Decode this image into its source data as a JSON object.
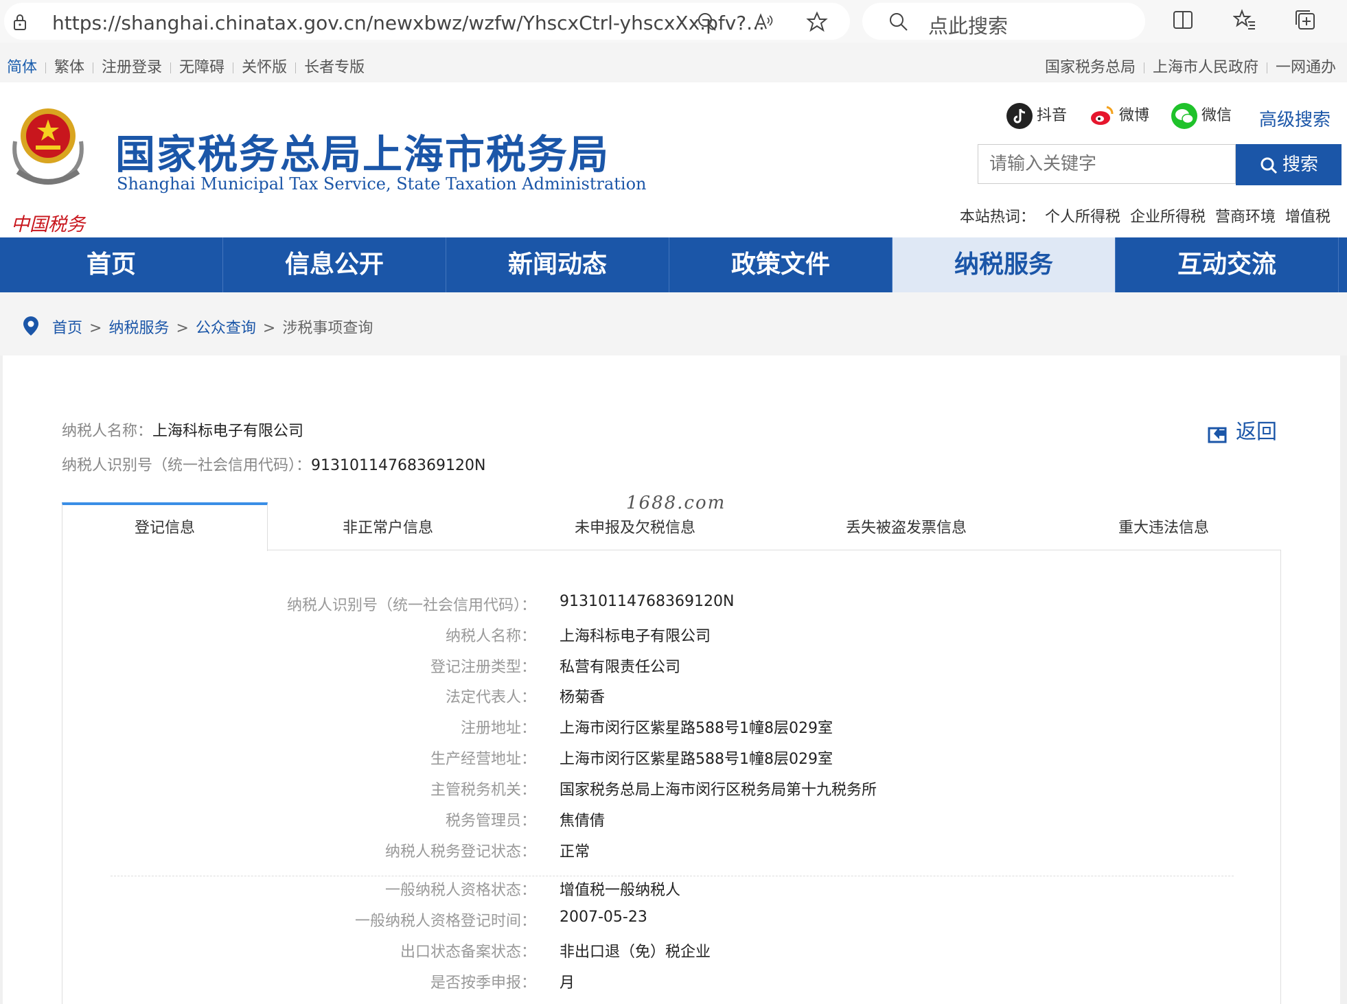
{
  "browser": {
    "url": "https://shanghai.chinatax.gov.cn/newxbwz/wzfw/YhscxCtrl-yhscxXx.pfv?...",
    "search_placeholder": "点此搜索"
  },
  "utility": {
    "left": [
      "简体",
      "繁体",
      "注册登录",
      "无障碍",
      "关怀版",
      "长者专版"
    ],
    "right": [
      "国家税务总局",
      "上海市人民政府",
      "一网通办"
    ]
  },
  "header": {
    "title": "国家税务总局上海市税务局",
    "subtitle": "Shanghai Municipal Tax Service, State Taxation Administration",
    "emblem_text": "中国税务",
    "social": [
      "抖音",
      "微博",
      "微信"
    ],
    "advanced_search": "高级搜索",
    "search_placeholder": "请输入关键字",
    "search_button": "搜索",
    "hot_label": "本站热词：",
    "hot_words": [
      "个人所得税",
      "企业所得税",
      "营商环境",
      "增值税"
    ]
  },
  "nav": [
    "首页",
    "信息公开",
    "新闻动态",
    "政策文件",
    "纳税服务",
    "互动交流"
  ],
  "breadcrumb": {
    "items": [
      "首页",
      "纳税服务",
      "公众查询"
    ],
    "current": "涉税事项查询"
  },
  "taxpayer": {
    "name_label": "纳税人名称：",
    "name": "上海科标电子有限公司",
    "id_label": "纳税人识别号（统一社会信用代码）：",
    "id": "91310114768369120N"
  },
  "back_label": "返回",
  "watermark": "1688.com",
  "tabs": [
    "登记信息",
    "非正常户信息",
    "未申报及欠税信息",
    "丢失被盗发票信息",
    "重大违法信息"
  ],
  "details": [
    {
      "k": "纳税人识别号（统一社会信用代码）：",
      "v": "91310114768369120N"
    },
    {
      "k": "纳税人名称：",
      "v": "上海科标电子有限公司"
    },
    {
      "k": "登记注册类型：",
      "v": "私营有限责任公司"
    },
    {
      "k": "法定代表人：",
      "v": "杨菊香"
    },
    {
      "k": "注册地址：",
      "v": "上海市闵行区紫星路588号1幢8层029室"
    },
    {
      "k": "生产经营地址：",
      "v": "上海市闵行区紫星路588号1幢8层029室"
    },
    {
      "k": "主管税务机关：",
      "v": "国家税务总局上海市闵行区税务局第十九税务所"
    },
    {
      "k": "税务管理员：",
      "v": "焦倩倩"
    },
    {
      "k": "纳税人税务登记状态：",
      "v": "正常"
    },
    {
      "k": "一般纳税人资格状态：",
      "v": "增值税一般纳税人"
    },
    {
      "k": "一般纳税人资格登记时间：",
      "v": "2007-05-23"
    },
    {
      "k": "出口状态备案状态：",
      "v": "非出口退（免）税企业"
    },
    {
      "k": "是否按季申报：",
      "v": "月"
    }
  ],
  "colors": {
    "brand": "#1b56a8",
    "tab_accent": "#3a8ee6",
    "active_nav_bg": "#dfe8f5"
  }
}
